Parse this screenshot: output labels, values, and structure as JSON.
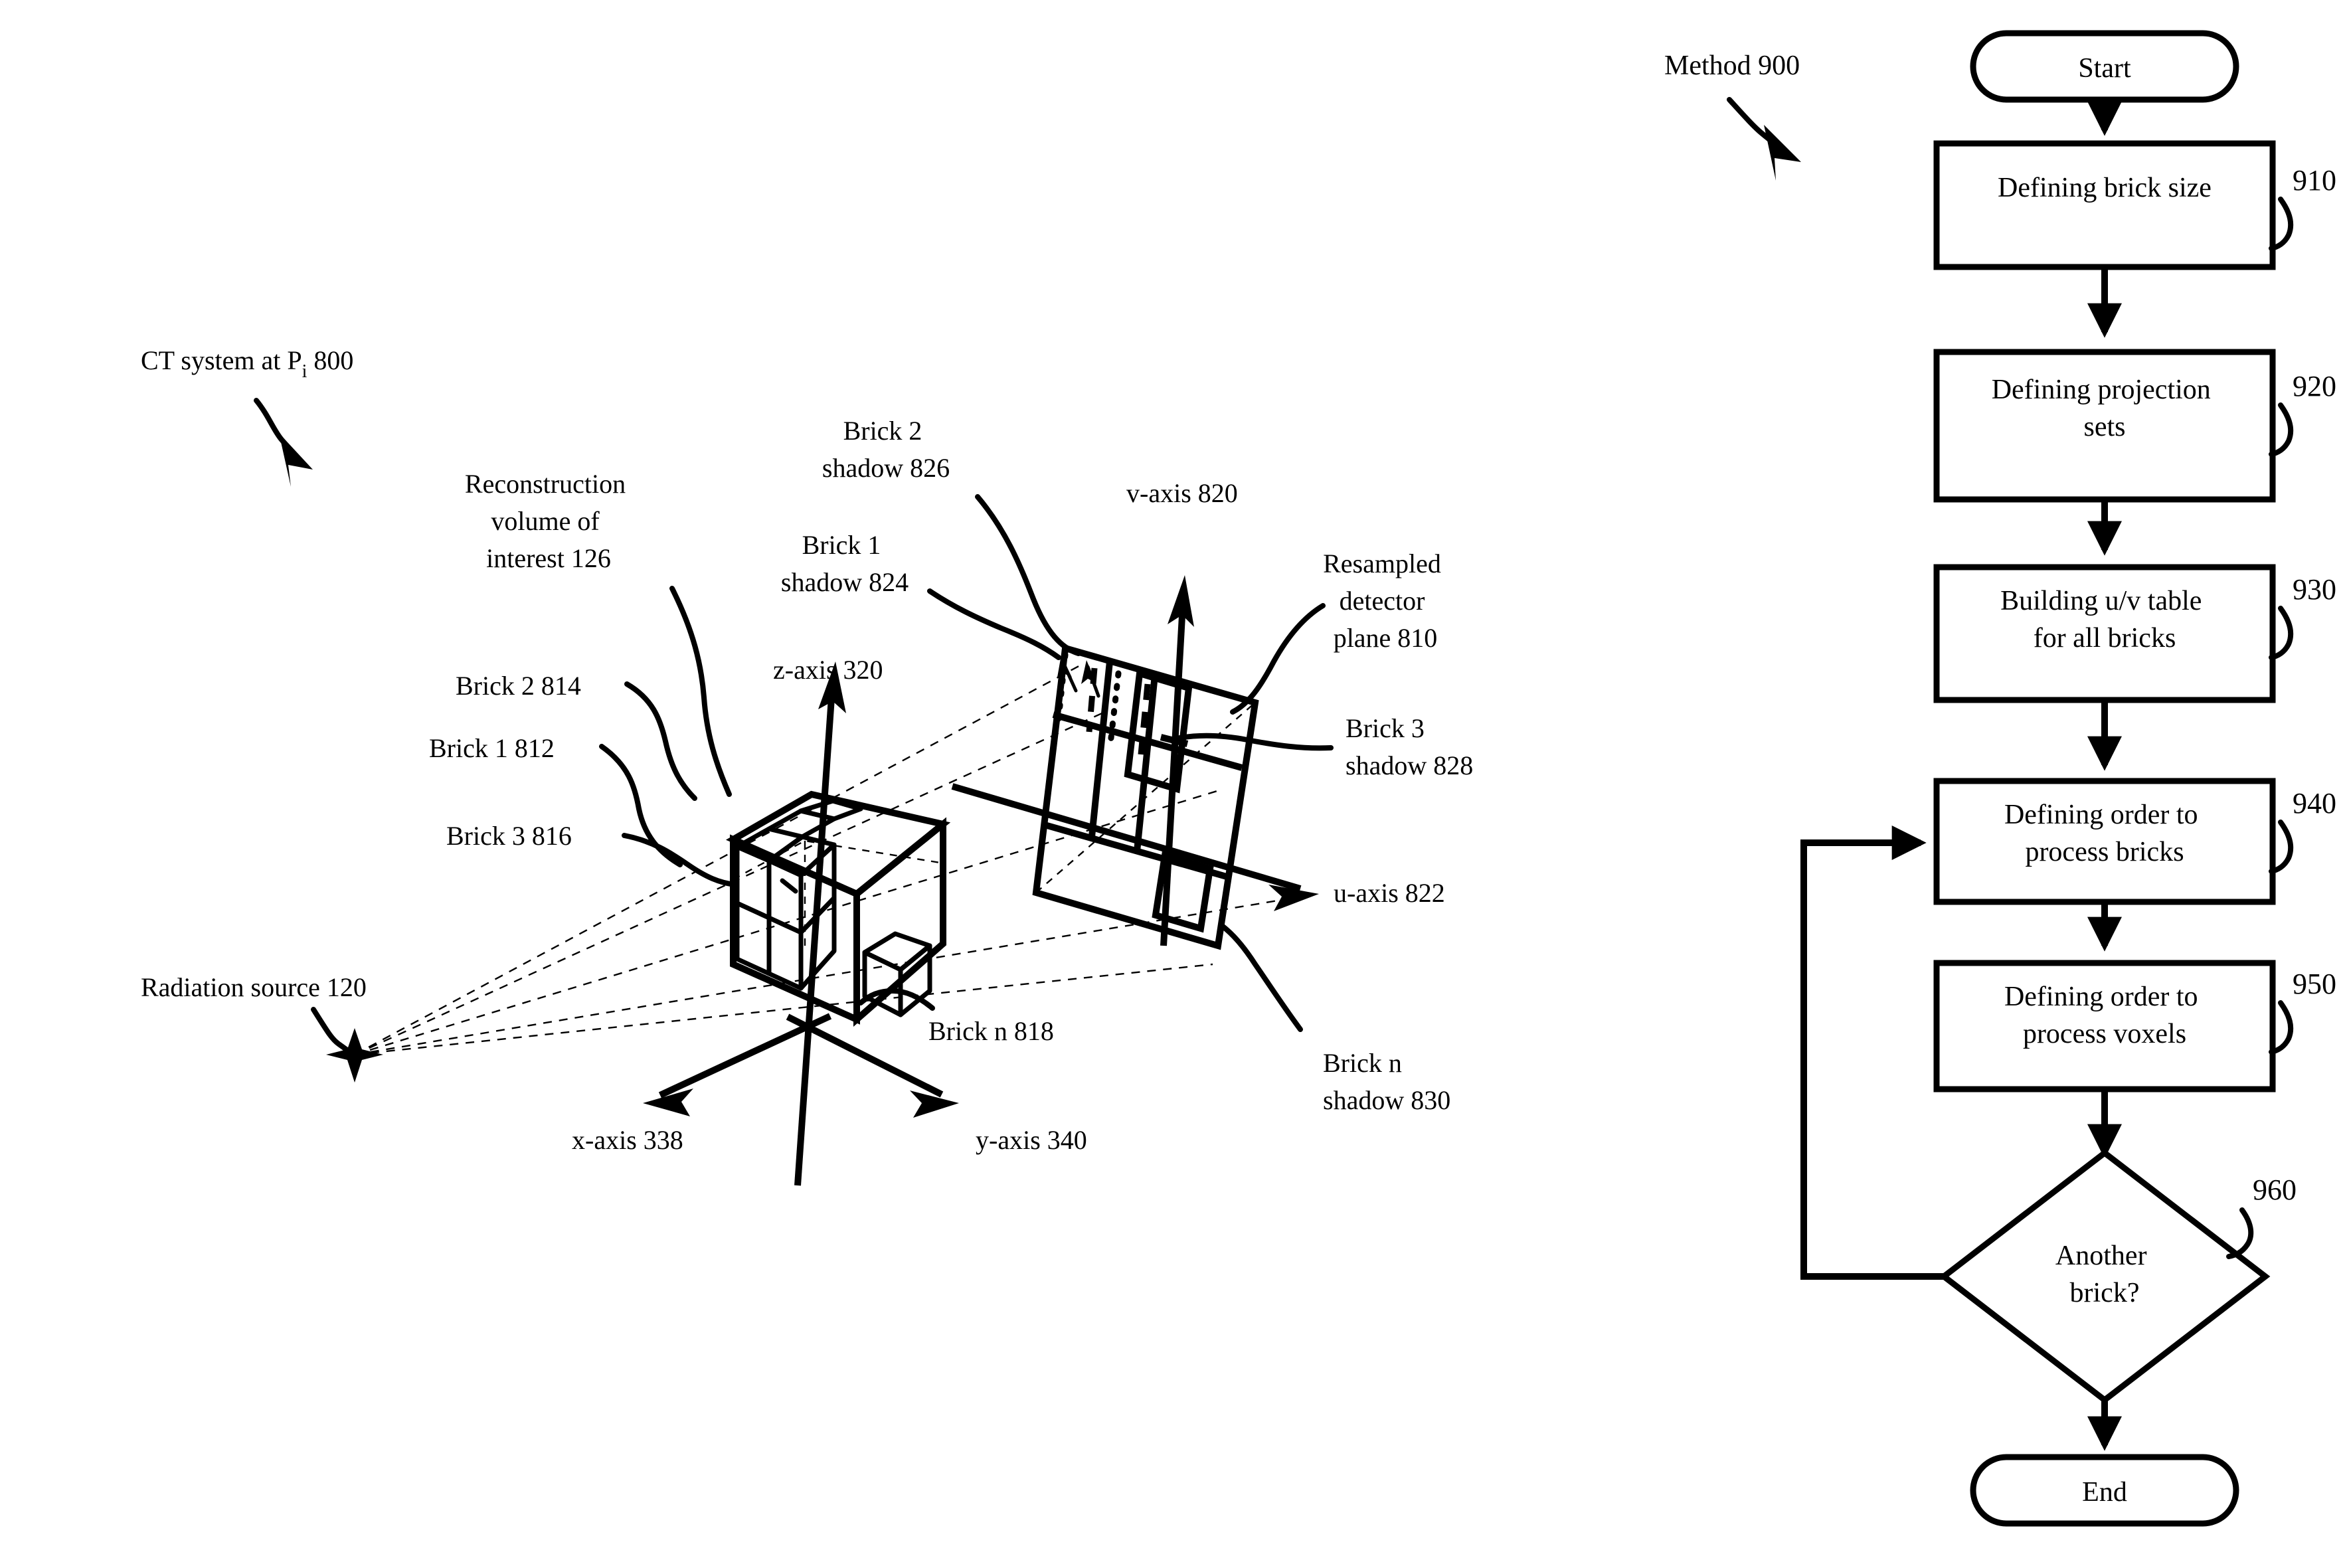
{
  "figure": {
    "left_diagram": {
      "title_label": "CT system at P",
      "title_sub": "i",
      "title_num": " 800",
      "labels": {
        "radiation_source": "Radiation source 120",
        "reconstruction_volume": [
          "Reconstruction",
          "volume of",
          "interest 126"
        ],
        "brick1": "Brick 1 812",
        "brick2": "Brick 2 814",
        "brick3": "Brick 3 816",
        "brickn": "Brick n 818",
        "brick1_shadow": [
          "Brick 1",
          "shadow 824"
        ],
        "brick2_shadow": [
          "Brick 2",
          "shadow 826"
        ],
        "brick3_shadow": [
          "Brick 3",
          "shadow 828"
        ],
        "brickn_shadow": [
          "Brick n",
          "shadow 830"
        ],
        "detector_plane": [
          "Resampled",
          "detector",
          "plane 810"
        ],
        "x_axis": "x-axis 338",
        "y_axis": "y-axis 340",
        "z_axis": "z-axis 320",
        "u_axis": "u-axis 822",
        "v_axis": "v-axis 820"
      }
    },
    "flowchart": {
      "method_label": "Method 900",
      "nodes": [
        {
          "id": "start",
          "shape": "terminator",
          "lines": [
            "Start"
          ],
          "ref": ""
        },
        {
          "id": "n910",
          "shape": "process",
          "lines": [
            "Defining brick size"
          ],
          "ref": "910"
        },
        {
          "id": "n920",
          "shape": "process",
          "lines": [
            "Defining projection",
            "sets"
          ],
          "ref": "920"
        },
        {
          "id": "n930",
          "shape": "process",
          "lines": [
            "Building u/v table",
            "for all bricks"
          ],
          "ref": "930"
        },
        {
          "id": "n940",
          "shape": "process",
          "lines": [
            "Defining order to",
            "process bricks"
          ],
          "ref": "940"
        },
        {
          "id": "n950",
          "shape": "process",
          "lines": [
            "Defining order to",
            "process voxels"
          ],
          "ref": "950"
        },
        {
          "id": "n960",
          "shape": "decision",
          "lines": [
            "Another",
            "brick?"
          ],
          "ref": "960"
        },
        {
          "id": "end",
          "shape": "terminator",
          "lines": [
            "End"
          ],
          "ref": ""
        }
      ]
    }
  },
  "colors": {
    "ink": "#000000",
    "paper": "#ffffff"
  }
}
